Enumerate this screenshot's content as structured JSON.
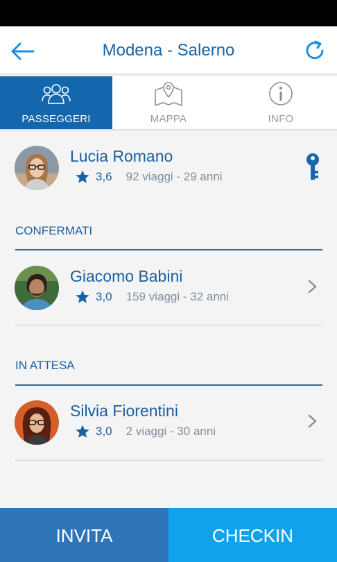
{
  "header": {
    "title": "Modena - Salerno",
    "back_icon": "arrow-left-icon",
    "refresh_icon": "refresh-icon"
  },
  "tabs": [
    {
      "label": "PASSEGGERI",
      "icon": "people-icon",
      "active": true
    },
    {
      "label": "MAPPA",
      "icon": "map-pin-icon",
      "active": false
    },
    {
      "label": "INFO",
      "icon": "info-icon",
      "active": false
    }
  ],
  "driver": {
    "name": "Lucia Romano",
    "rating": "3,6",
    "trips": "92 viaggi - 29 anni",
    "badge_icon": "key-icon"
  },
  "sections": {
    "confirmed": {
      "title": "CONFERMATI",
      "people": [
        {
          "name": "Giacomo Babini",
          "rating": "3,0",
          "trips": "159 viaggi - 32 anni"
        }
      ]
    },
    "pending": {
      "title": "IN ATTESA",
      "people": [
        {
          "name": "Silvia Fiorentini",
          "rating": "3,0",
          "trips": "2 viaggi - 30 anni"
        }
      ]
    }
  },
  "actions": {
    "invite_label": "INVITA",
    "checkin_label": "CHECKIN"
  },
  "colors": {
    "primary": "#1467ad",
    "accent": "#12a2ec",
    "text_blue": "#1a5fa0",
    "muted": "#7f8e9c"
  }
}
